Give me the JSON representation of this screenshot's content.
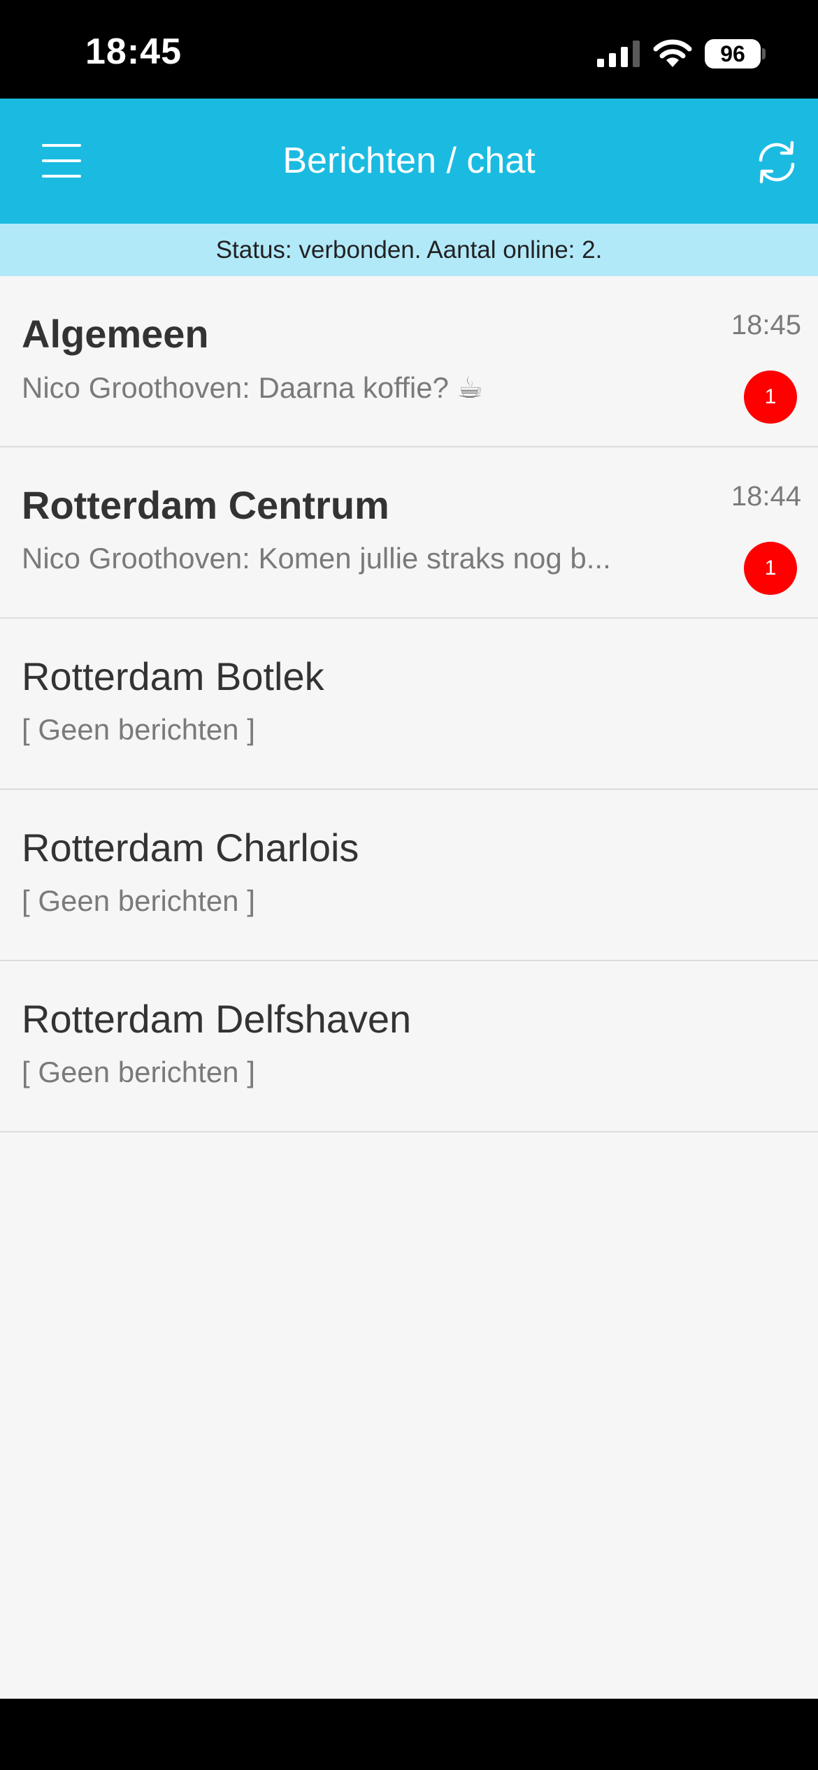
{
  "status_bar": {
    "time": "18:45",
    "battery": "96"
  },
  "header": {
    "title": "Berichten / chat",
    "menu_icon": "hamburger-menu-icon",
    "refresh_icon": "refresh-icon"
  },
  "connection": {
    "text": "Status: verbonden. Aantal online: 2."
  },
  "colors": {
    "header": "#1bbbe1",
    "status_strip": "#b2e9f9",
    "badge": "#ff0000"
  },
  "chats": [
    {
      "name": "Algemeen",
      "preview": "Nico Groothoven: Daarna koffie? ☕",
      "time": "18:45",
      "unread": "1"
    },
    {
      "name": "Rotterdam Centrum",
      "preview": "Nico Groothoven: Komen jullie straks nog b...",
      "time": "18:44",
      "unread": "1"
    },
    {
      "name": "Rotterdam Botlek",
      "preview": "[ Geen berichten ]"
    },
    {
      "name": "Rotterdam Charlois",
      "preview": "[ Geen berichten ]"
    },
    {
      "name": "Rotterdam Delfshaven",
      "preview": "[ Geen berichten ]"
    }
  ]
}
